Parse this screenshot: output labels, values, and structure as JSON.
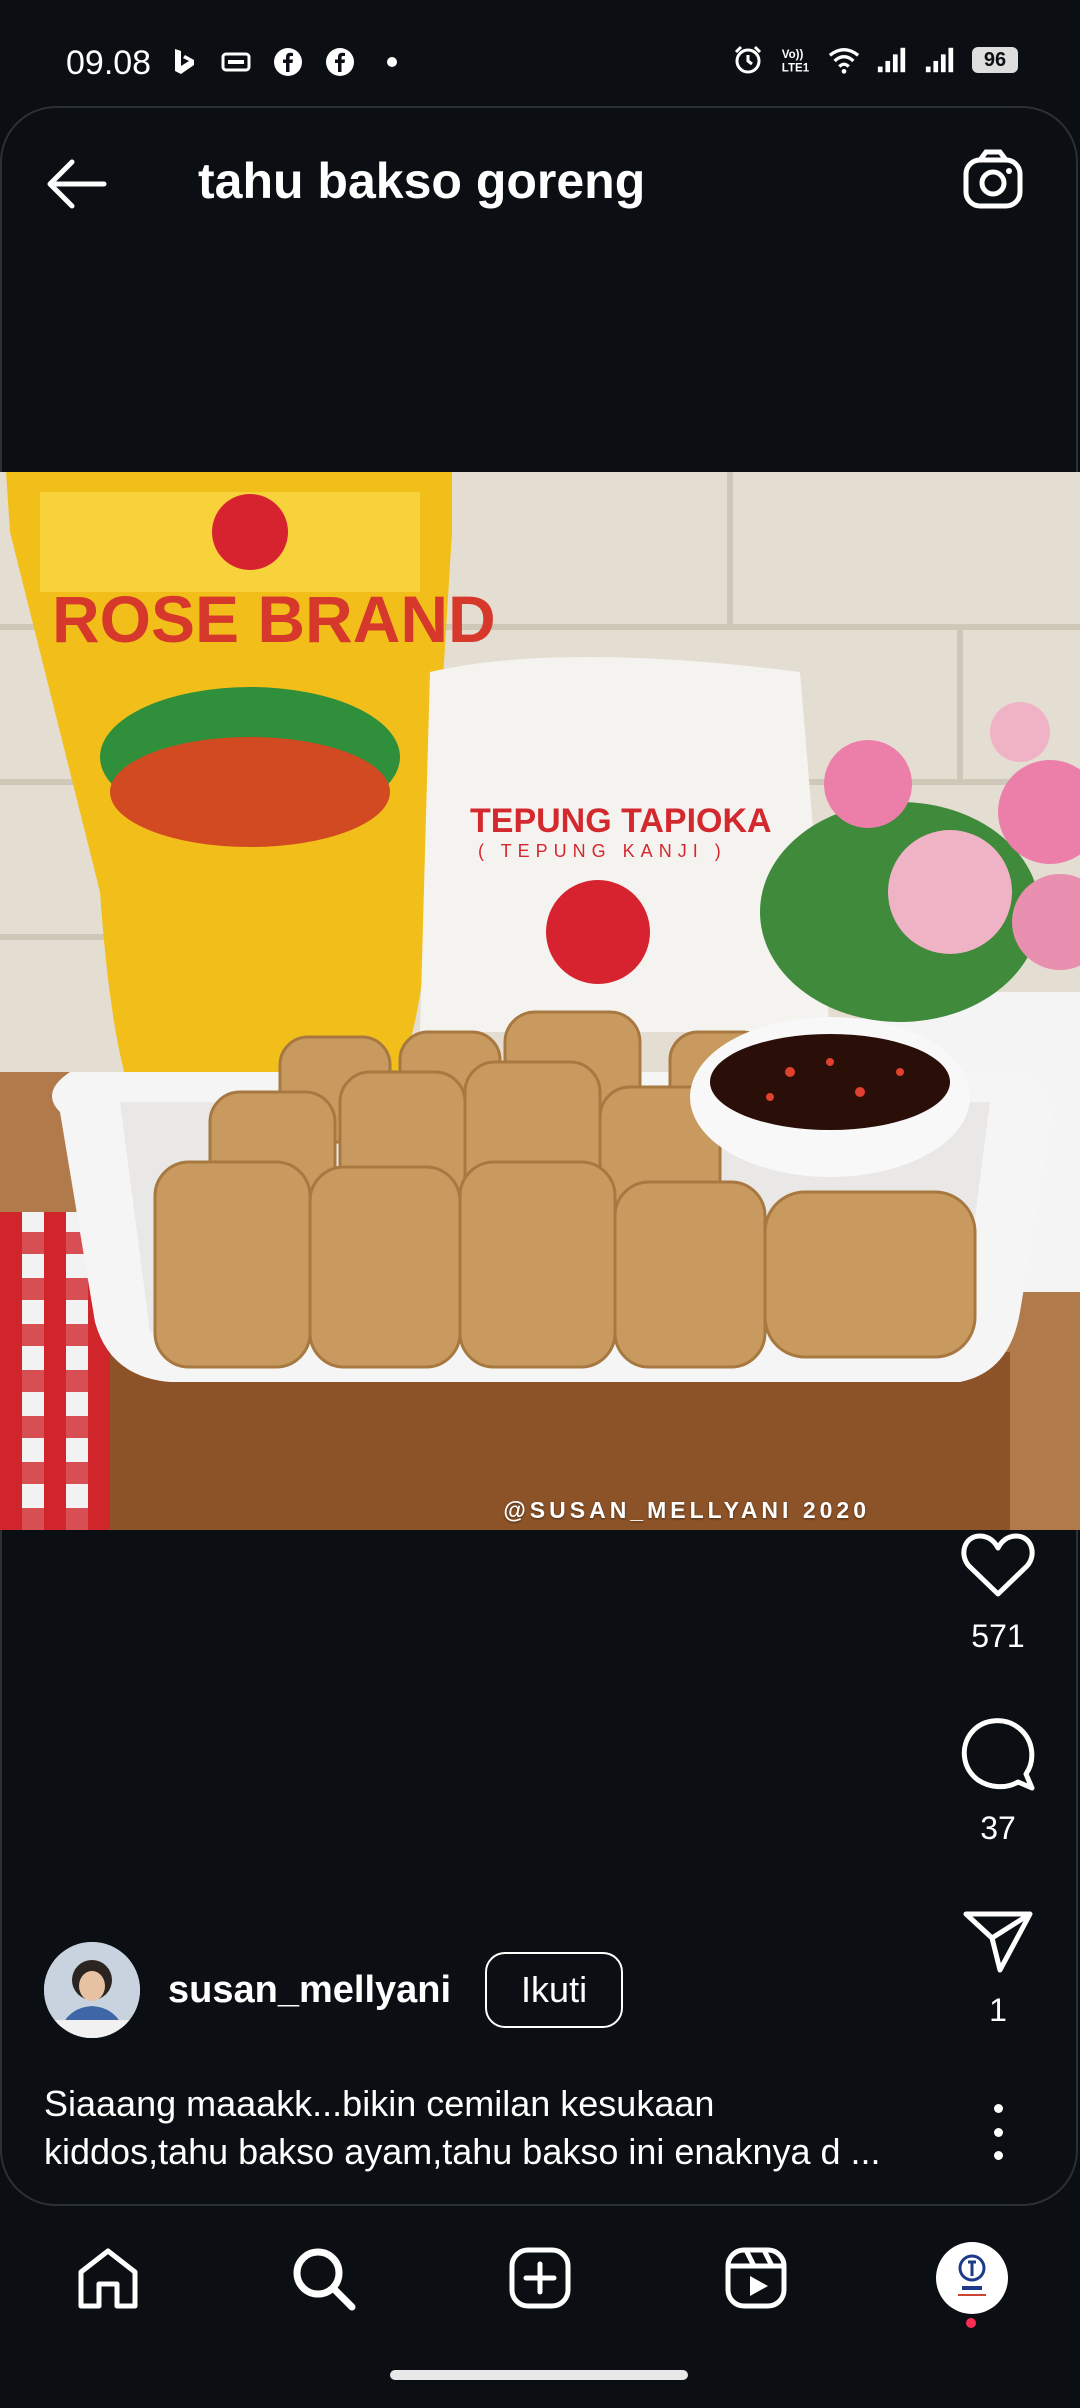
{
  "status_bar": {
    "time": "09.08",
    "left_icons": [
      "b-icon",
      "card-icon",
      "facebook-icon",
      "facebook-icon",
      "dot-icon"
    ],
    "right_icons": [
      "alarm-icon",
      "volte-icon",
      "wifi-icon",
      "signal-icon",
      "signal-icon"
    ],
    "battery": "96"
  },
  "header": {
    "title": "tahu bakso goreng",
    "back_icon": "back-arrow-icon",
    "camera_icon": "camera-icon"
  },
  "post": {
    "watermark": "@SUSAN_MELLYANI 2020",
    "likes": "571",
    "comments": "37",
    "shares": "1",
    "username": "susan_mellyani",
    "follow_label": "Ikuti",
    "caption_lines": [
      "Siaaang maaakk...bikin cemilan kesukaan",
      "kiddos,tahu bakso ayam,tahu bakso ini enaknya d ..."
    ]
  },
  "nav": {
    "items": [
      "home-icon",
      "search-icon",
      "add-post-icon",
      "reels-icon",
      "profile-avatar"
    ]
  },
  "colors": {
    "background": "#0b0e13",
    "text": "#ffffff",
    "notification_dot": "#ff2d55"
  }
}
